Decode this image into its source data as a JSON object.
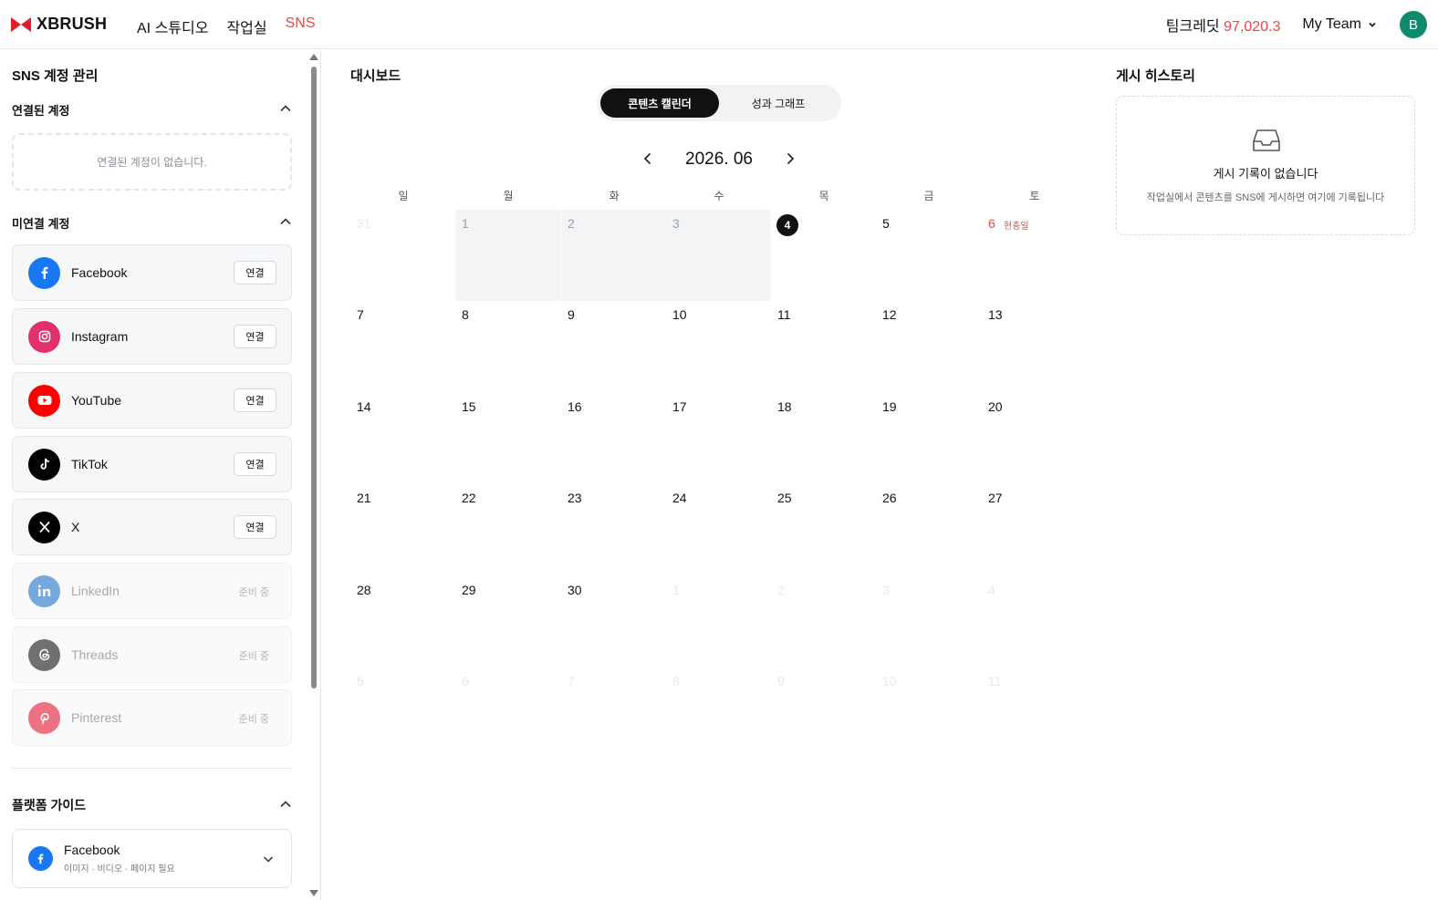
{
  "header": {
    "logo": "XBRUSH",
    "nav": [
      "AI 스튜디오",
      "작업실",
      "SNS"
    ],
    "active_nav": "SNS",
    "credit_label": "팀크레딧",
    "credit_value": "97,020.3",
    "team_label": "My Team",
    "avatar_initial": "B",
    "accent_color": "#ef4444"
  },
  "sidebar": {
    "title": "SNS 계정 관리",
    "connected_title": "연결된 계정",
    "connected_empty": "연결된 계정이 없습니다.",
    "unconnected_title": "미연결 계정",
    "accounts": [
      {
        "name": "Facebook",
        "action": "연결",
        "icon": "facebook-icon",
        "color": "#1877f2"
      },
      {
        "name": "Instagram",
        "action": "연결",
        "icon": "instagram-icon",
        "color": "#e1306c"
      },
      {
        "name": "YouTube",
        "action": "연결",
        "icon": "youtube-icon",
        "color": "#ff0000"
      },
      {
        "name": "TikTok",
        "action": "연결",
        "icon": "tiktok-icon",
        "color": "#000000"
      },
      {
        "name": "X",
        "action": "연결",
        "icon": "x-icon",
        "color": "#000000"
      },
      {
        "name": "LinkedIn",
        "action": "준비 중",
        "icon": "linkedin-icon",
        "color": "#0a66c2"
      },
      {
        "name": "Threads",
        "action": "준비 중",
        "icon": "threads-icon",
        "color": "#000000"
      },
      {
        "name": "Pinterest",
        "action": "준비 중",
        "icon": "pinterest-icon",
        "color": "#e60023"
      }
    ],
    "guide_title": "플랫폼 가이드",
    "guide_item": {
      "name": "Facebook",
      "desc": "이미지 · 비디오 · 페이지 필요"
    }
  },
  "dashboard": {
    "title": "대시보드",
    "tabs": [
      "콘텐츠 캘린더",
      "성과 그래프"
    ],
    "active_tab": "콘텐츠 캘린더",
    "month": "2026. 06",
    "weekdays": [
      "일",
      "월",
      "화",
      "수",
      "목",
      "금",
      "토"
    ],
    "weeks": [
      [
        "31",
        "1",
        "2",
        "3",
        "4",
        "5",
        "6"
      ],
      [
        "7",
        "8",
        "9",
        "10",
        "11",
        "12",
        "13"
      ],
      [
        "14",
        "15",
        "16",
        "17",
        "18",
        "19",
        "20"
      ],
      [
        "21",
        "22",
        "23",
        "24",
        "25",
        "26",
        "27"
      ],
      [
        "28",
        "29",
        "30",
        "1",
        "2",
        "3",
        "4"
      ],
      [
        "5",
        "6",
        "7",
        "8",
        "9",
        "10",
        "11"
      ]
    ],
    "today": "4",
    "holiday": {
      "day": "6",
      "label": "현충일"
    }
  },
  "history": {
    "title": "게시 히스토리",
    "empty_title": "게시 기록이 없습니다",
    "empty_desc": "작업실에서 콘텐츠를 SNS에 게시하면 여기에 기록됩니다"
  }
}
